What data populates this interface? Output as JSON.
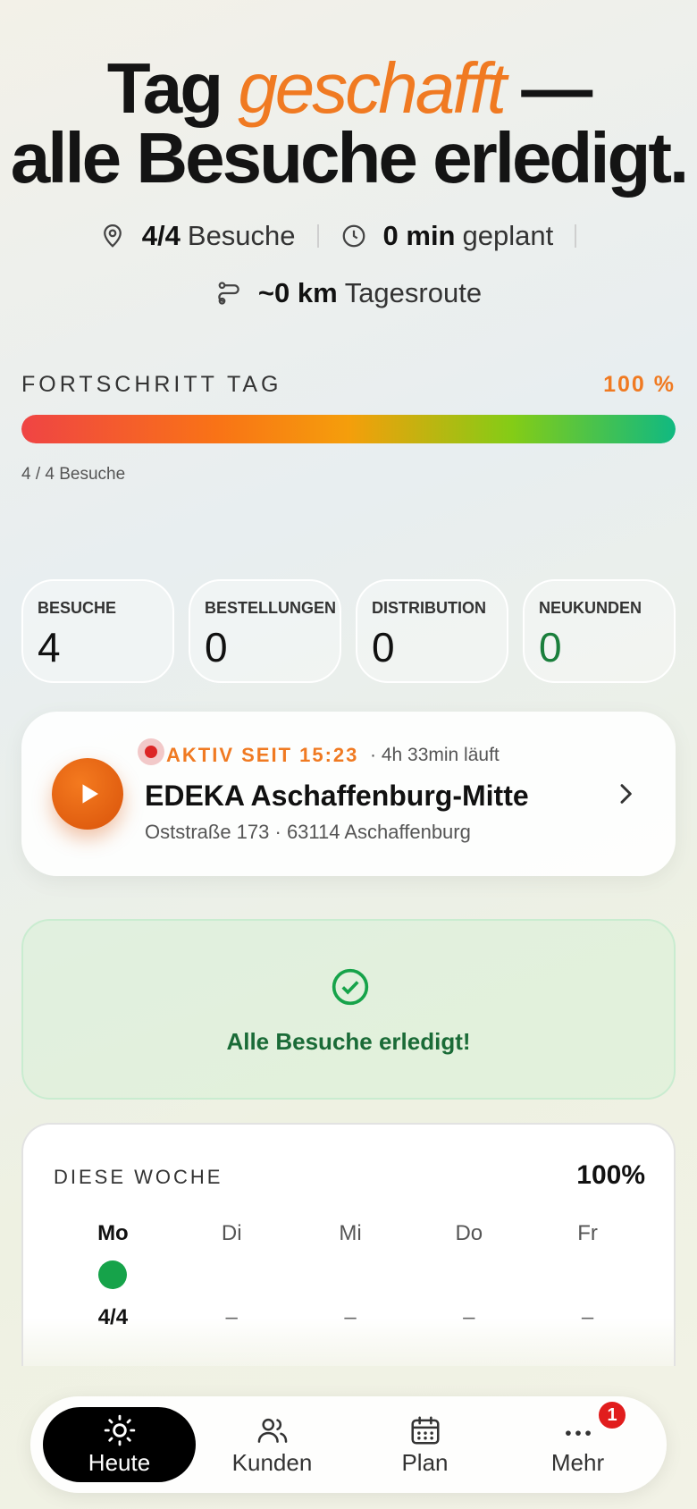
{
  "hero": {
    "line1_prefix": "Tag ",
    "line1_accent": "geschafft",
    "line1_suffix": " —",
    "line2": "alle Besuche erledigt."
  },
  "summary": {
    "visits_value": "4/4",
    "visits_label": "Besuche",
    "planned_value": "0 min",
    "planned_label": "geplant",
    "route_value": "~0 km",
    "route_label": "Tagesroute"
  },
  "progress": {
    "label": "FORTSCHRITT TAG",
    "percent_text": "100 %",
    "fraction": 1.0,
    "subtitle": "4 / 4 Besuche"
  },
  "stats": [
    {
      "label": "BESUCHE",
      "value": "4"
    },
    {
      "label": "BESTELLUNGEN",
      "value": "0"
    },
    {
      "label": "DISTRIBUTION",
      "value": "0"
    },
    {
      "label": "NEUKUNDEN",
      "value": "0"
    }
  ],
  "active_visit": {
    "status": "AKTIV SEIT 15:23",
    "duration": "· 4h 33min läuft",
    "store": "EDEKA Aschaffenburg-Mitte",
    "address": "Oststraße 173 · 63114 Aschaffenburg"
  },
  "done_message": "Alle Besuche erledigt!",
  "week": {
    "label": "DIESE WOCHE",
    "percent": "100%",
    "days": [
      {
        "name": "Mo",
        "count": "4/4",
        "done": true
      },
      {
        "name": "Di",
        "count": "–",
        "done": false
      },
      {
        "name": "Mi",
        "count": "–",
        "done": false
      },
      {
        "name": "Do",
        "count": "–",
        "done": false
      },
      {
        "name": "Fr",
        "count": "–",
        "done": false
      }
    ]
  },
  "nav": {
    "items": [
      {
        "label": "Heute",
        "icon": "sun-icon"
      },
      {
        "label": "Kunden",
        "icon": "users-icon"
      },
      {
        "label": "Plan",
        "icon": "calendar-icon"
      },
      {
        "label": "Mehr",
        "icon": "more-icon"
      }
    ],
    "more_badge": "1"
  },
  "colors": {
    "accent": "#f07a22",
    "success": "#16a34a",
    "record": "#dc2626"
  }
}
